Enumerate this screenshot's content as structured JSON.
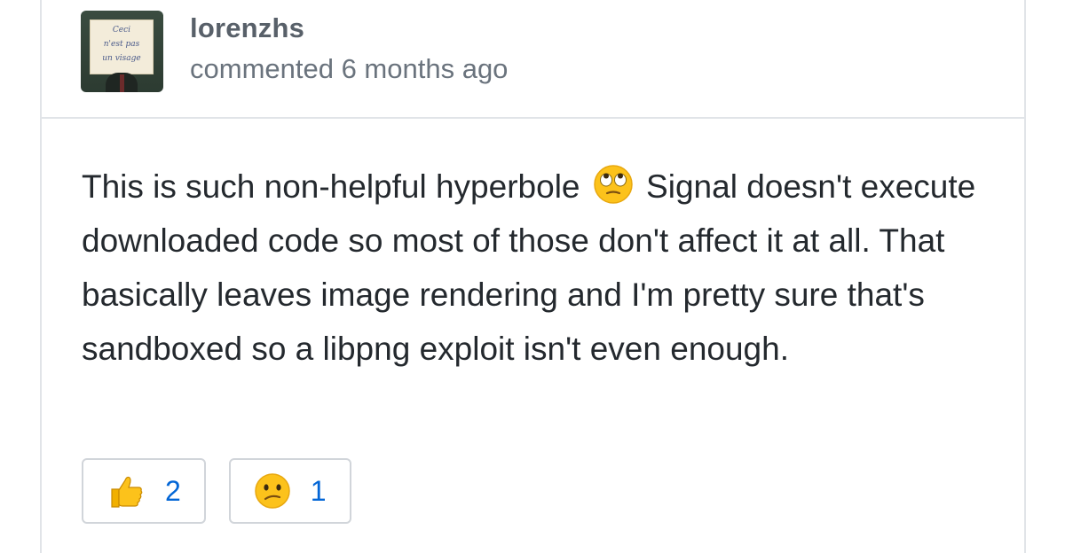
{
  "comment": {
    "author": "lorenzhs",
    "timestamp": "commented 6 months ago",
    "avatar_text": [
      "Ceci",
      "n'est pas",
      "un visage"
    ],
    "body_before_emoji": "This is such non-helpful hyperbole",
    "body_emoji": "face-with-rolling-eyes-icon",
    "body_after_emoji": " Signal doesn't execute downloaded code so most of those don't affect it at all. That basically leaves image rendering and I'm pretty sure that's sandboxed so a libpng exploit isn't even enough."
  },
  "reactions": [
    {
      "icon": "thumbs-up-icon",
      "count": "2"
    },
    {
      "icon": "confused-face-icon",
      "count": "1"
    }
  ],
  "colors": {
    "border": "#e1e4e8",
    "text": "#24292e",
    "muted": "#6a737d",
    "link": "#0366d6"
  }
}
